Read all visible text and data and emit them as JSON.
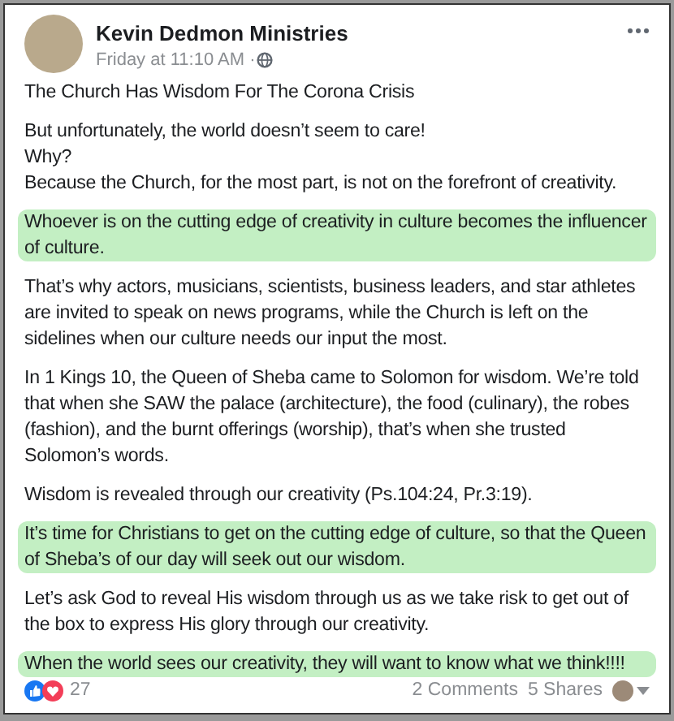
{
  "post": {
    "author": "Kevin Dedmon Ministries",
    "time": "Friday at 11:10 AM · ",
    "paragraphs": [
      {
        "text": "The Church Has Wisdom For The Corona Crisis",
        "highlighted": false
      },
      {
        "text": "But unfortunately, the world doesn’t seem to care!\nWhy?\nBecause the Church, for the most part, is not on the forefront of creativity.",
        "highlighted": false
      },
      {
        "text": "Whoever is on the cutting edge of creativity in culture becomes the influencer of culture.",
        "highlighted": true
      },
      {
        "text": "That’s why actors, musicians, scientists, business leaders, and star athletes are invited to speak on news programs, while the Church is left on the sidelines when our culture needs our input the most.",
        "highlighted": false
      },
      {
        "text": "In 1 Kings 10, the Queen of Sheba came to Solomon for wisdom.  We’re told that when she SAW the palace (architecture), the food (culinary), the robes (fashion), and the burnt offerings (worship), that’s when she trusted Solomon’s words.",
        "highlighted": false
      },
      {
        "text": "Wisdom is revealed through our creativity (Ps.104:24, Pr.3:19).",
        "highlighted": false
      },
      {
        "text": "It’s time for Christians to get on the cutting edge of culture, so that the Queen of Sheba’s of our day will seek out our wisdom.",
        "highlighted": true
      },
      {
        "text": "Let’s ask God to reveal His wisdom through us as we take risk to get out of the box to express His glory through our creativity.",
        "highlighted": false
      },
      {
        "text": "When the world sees our creativity, they will want to know what we think!!!!",
        "highlighted": true
      }
    ],
    "reactions": "27",
    "comments": "2 Comments",
    "shares": "5 Shares"
  }
}
